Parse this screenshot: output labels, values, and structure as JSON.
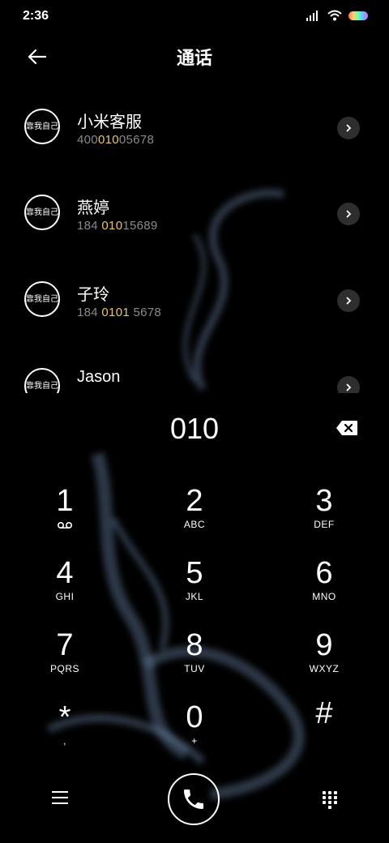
{
  "status_bar": {
    "time": "2:36"
  },
  "header": {
    "title": "通话"
  },
  "contacts": [
    {
      "name": "小米客服",
      "number_parts": [
        "400",
        "010",
        "05678"
      ]
    },
    {
      "name": "燕婷",
      "number_parts": [
        "184 ",
        "010",
        "15689"
      ]
    },
    {
      "name": "子玲",
      "number_parts": [
        "184 ",
        "0101",
        " 5678"
      ]
    },
    {
      "name": "Jason",
      "number_parts": [
        "",
        "",
        ""
      ]
    }
  ],
  "avatar_text": "靠我自己",
  "dialer": {
    "input": "010",
    "keys": [
      {
        "digit": "1",
        "letters": ""
      },
      {
        "digit": "2",
        "letters": "ABC"
      },
      {
        "digit": "3",
        "letters": "DEF"
      },
      {
        "digit": "4",
        "letters": "GHI"
      },
      {
        "digit": "5",
        "letters": "JKL"
      },
      {
        "digit": "6",
        "letters": "MNO"
      },
      {
        "digit": "7",
        "letters": "PQRS"
      },
      {
        "digit": "8",
        "letters": "TUV"
      },
      {
        "digit": "9",
        "letters": "WXYZ"
      },
      {
        "digit": "*",
        "letters": ","
      },
      {
        "digit": "0",
        "letters": "+"
      },
      {
        "digit": "#",
        "letters": ""
      }
    ]
  },
  "colors": {
    "background": "#000000",
    "highlight": "#e8c56a",
    "secondary_text": "#8a8a8a"
  },
  "icons": {
    "back": "arrow-left-icon",
    "backspace": "backspace-icon",
    "menu": "menu-icon",
    "call": "phone-icon",
    "keypad": "dialpad-icon",
    "voicemail": "voicemail-icon"
  }
}
